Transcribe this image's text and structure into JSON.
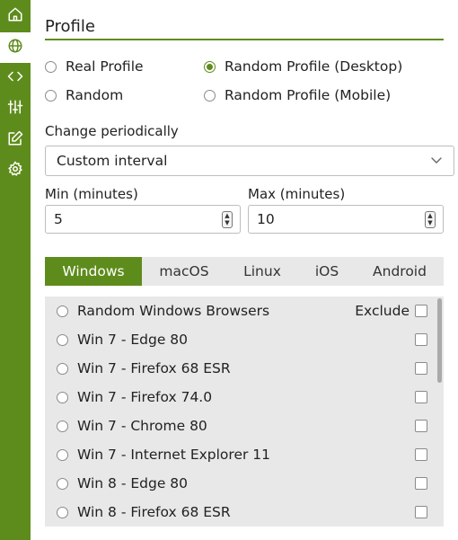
{
  "sidebar": {
    "items": [
      {
        "icon": "home-icon"
      },
      {
        "icon": "globe-icon"
      },
      {
        "icon": "code-icon"
      },
      {
        "icon": "sliders-icon"
      },
      {
        "icon": "edit-icon"
      },
      {
        "icon": "gear-icon"
      }
    ],
    "active_index": 1
  },
  "profile": {
    "title": "Profile",
    "options": [
      {
        "label": "Real Profile",
        "checked": false
      },
      {
        "label": "Random Profile (Desktop)",
        "checked": true
      },
      {
        "label": "Random",
        "checked": false
      },
      {
        "label": "Random Profile (Mobile)",
        "checked": false
      }
    ]
  },
  "interval": {
    "label": "Change periodically",
    "selected": "Custom interval"
  },
  "min": {
    "label": "Min (minutes)",
    "value": "5"
  },
  "max": {
    "label": "Max (minutes)",
    "value": "10"
  },
  "tabs": [
    "Windows",
    "macOS",
    "Linux",
    "iOS",
    "Android"
  ],
  "active_tab": "Windows",
  "browsers": {
    "exclude_label": "Exclude",
    "items": [
      "Random Windows Browsers",
      "Win 7 - Edge 80",
      "Win 7 - Firefox 68 ESR",
      "Win 7 - Firefox 74.0",
      "Win 7 - Chrome 80",
      "Win 7 - Internet Explorer 11",
      "Win 8 - Edge 80",
      "Win 8 - Firefox 68 ESR"
    ]
  },
  "colors": {
    "accent": "#5e8c1c",
    "panel": "#e8e8e8"
  }
}
